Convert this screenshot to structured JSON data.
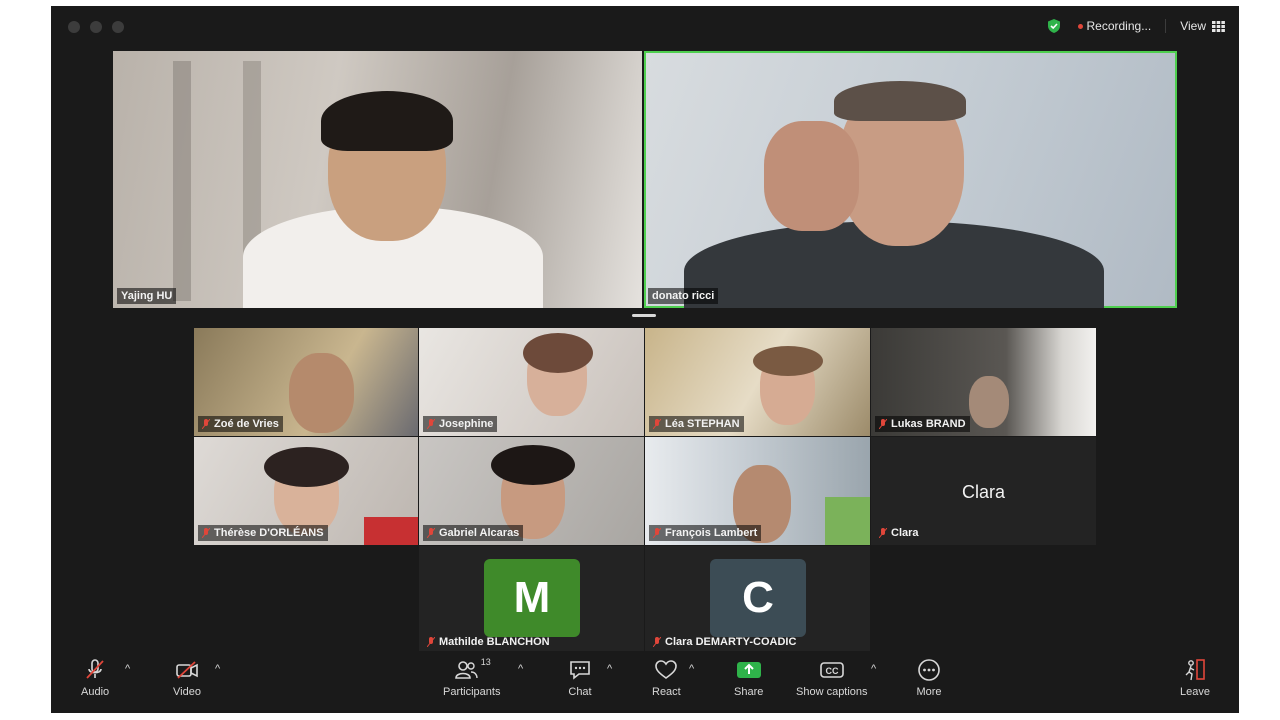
{
  "window": {
    "recording_label": "Recording...",
    "view_label": "View"
  },
  "speakers": [
    {
      "name": "Yajing HU"
    },
    {
      "name": "donato ricci"
    }
  ],
  "gallery": [
    {
      "name": "Zoé de Vries"
    },
    {
      "name": "Josephine"
    },
    {
      "name": "Léa STEPHAN"
    },
    {
      "name": "Lukas BRAND"
    },
    {
      "name": "Thérèse D'ORLÉANS"
    },
    {
      "name": "Gabriel Alcaras"
    },
    {
      "name": "François Lambert"
    },
    {
      "name": "Clara",
      "big_label": "Clara"
    },
    {
      "name": "Mathilde BLANCHON",
      "initial": "M"
    },
    {
      "name": "Clara DEMARTY-COADIC",
      "initial": "C"
    }
  ],
  "toolbar": {
    "audio": "Audio",
    "video": "Video",
    "participants": "Participants",
    "participants_count": "13",
    "chat": "Chat",
    "react": "React",
    "share": "Share",
    "captions": "Show captions",
    "more": "More",
    "leave": "Leave"
  },
  "colors": {
    "active_speaker_border": "#4fcf4f",
    "share_green": "#2fb34a",
    "avatar_m": "#3f8a2a",
    "avatar_c": "#3c4c55"
  }
}
